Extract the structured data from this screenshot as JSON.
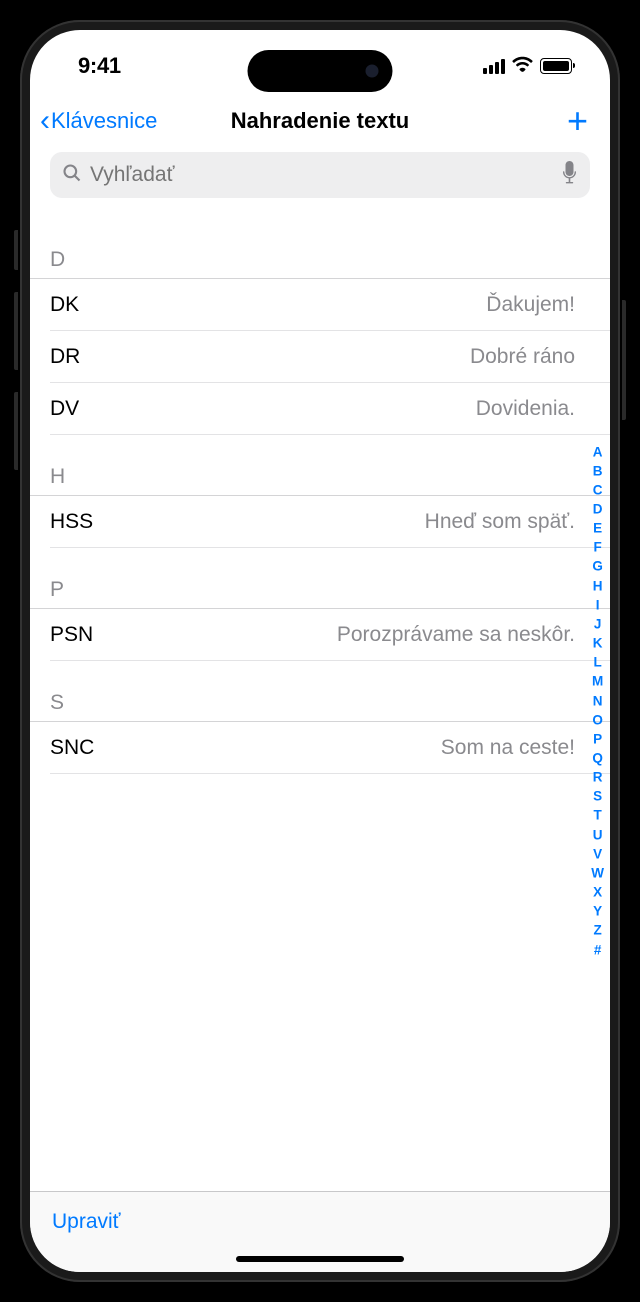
{
  "status": {
    "time": "9:41"
  },
  "nav": {
    "back_label": "Klávesnice",
    "title": "Nahradenie textu"
  },
  "search": {
    "placeholder": "Vyhľadať"
  },
  "sections": [
    {
      "letter": "D",
      "items": [
        {
          "shortcut": "DK",
          "phrase": "Ďakujem!"
        },
        {
          "shortcut": "DR",
          "phrase": "Dobré ráno"
        },
        {
          "shortcut": "DV",
          "phrase": "Dovidenia."
        }
      ]
    },
    {
      "letter": "H",
      "items": [
        {
          "shortcut": "HSS",
          "phrase": "Hneď som späť."
        }
      ]
    },
    {
      "letter": "P",
      "items": [
        {
          "shortcut": "PSN",
          "phrase": "Porozprávame sa neskôr."
        }
      ]
    },
    {
      "letter": "S",
      "items": [
        {
          "shortcut": "SNC",
          "phrase": "Som na ceste!"
        }
      ]
    }
  ],
  "index": [
    "A",
    "B",
    "C",
    "D",
    "E",
    "F",
    "G",
    "H",
    "I",
    "J",
    "K",
    "L",
    "M",
    "N",
    "O",
    "P",
    "Q",
    "R",
    "S",
    "T",
    "U",
    "V",
    "W",
    "X",
    "Y",
    "Z",
    "#"
  ],
  "toolbar": {
    "edit_label": "Upraviť"
  }
}
